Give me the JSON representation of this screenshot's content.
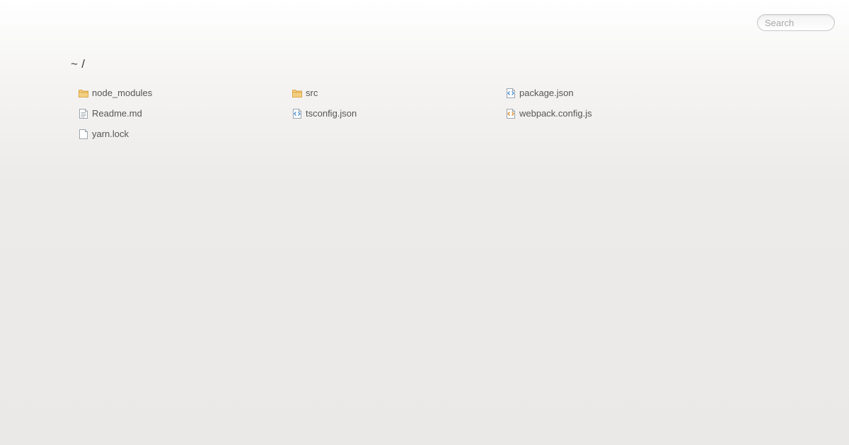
{
  "search": {
    "placeholder": "Search",
    "value": ""
  },
  "breadcrumb": {
    "path": "~ /"
  },
  "files": [
    {
      "name": "node_modules",
      "icon": "folder-icon"
    },
    {
      "name": "src",
      "icon": "folder-icon"
    },
    {
      "name": "package.json",
      "icon": "code-file-blue-icon"
    },
    {
      "name": "Readme.md",
      "icon": "text-file-icon"
    },
    {
      "name": "tsconfig.json",
      "icon": "code-file-blue-icon"
    },
    {
      "name": "webpack.config.js",
      "icon": "code-file-orange-icon"
    },
    {
      "name": "yarn.lock",
      "icon": "blank-file-icon"
    }
  ],
  "colors": {
    "folder": "#e8b450",
    "code_blue": "#4a8fd4",
    "code_orange": "#d98a2b",
    "text": "#555555"
  }
}
